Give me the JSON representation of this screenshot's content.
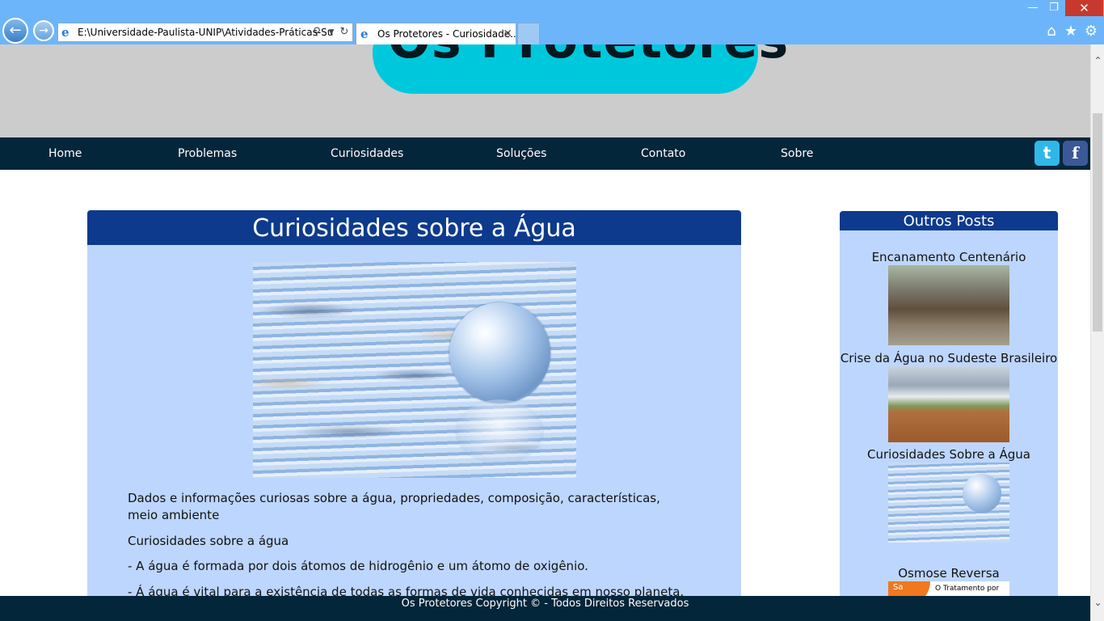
{
  "browser": {
    "address": "E:\\Universidade-Paulista-UNIP\\Atividades-Práticas-Su",
    "tab_title": "Os Protetores - Curiosidade...",
    "back_icon": "back-arrow-icon",
    "forward_icon": "forward-arrow-icon"
  },
  "site": {
    "logo": "Os Protetores",
    "nav": [
      "Home",
      "Problemas",
      "Curiosidades",
      "Soluções",
      "Contato",
      "Sobre"
    ],
    "social": {
      "twitter": "t",
      "facebook": "f"
    }
  },
  "article": {
    "title": "Curiosidades sobre a Água",
    "paragraphs": [
      "Dados e informações curiosas sobre a água, propriedades, composição, características, meio ambiente",
      "Curiosidades sobre a água",
      "- A água é formada por dois átomos de hidrogênio e um átomo de oxigênio.",
      "- Á água é vital para a existência de todas as formas de vida conhecidas em nosso planeta."
    ]
  },
  "sidebar": {
    "title": "Outros Posts",
    "posts": [
      "Encanamento Centenário",
      "Crise da Água no Sudeste Brasileiro",
      "Curiosidades Sobre a Água",
      "Osmose Reversa"
    ],
    "osmose_thumb_text": "O Tratamento por",
    "osmose_badge": "Sa"
  },
  "footer": {
    "text": "Os Protetores Copyright © - Todos Direitos Reservados"
  },
  "colors": {
    "chrome": "#6db5fb",
    "header_bg": "#cccccc",
    "logo_accent": "#00c8dc",
    "nav_bg": "#04263a",
    "panel_bg": "#bdd6fd",
    "panel_head": "#0d3a8c"
  }
}
